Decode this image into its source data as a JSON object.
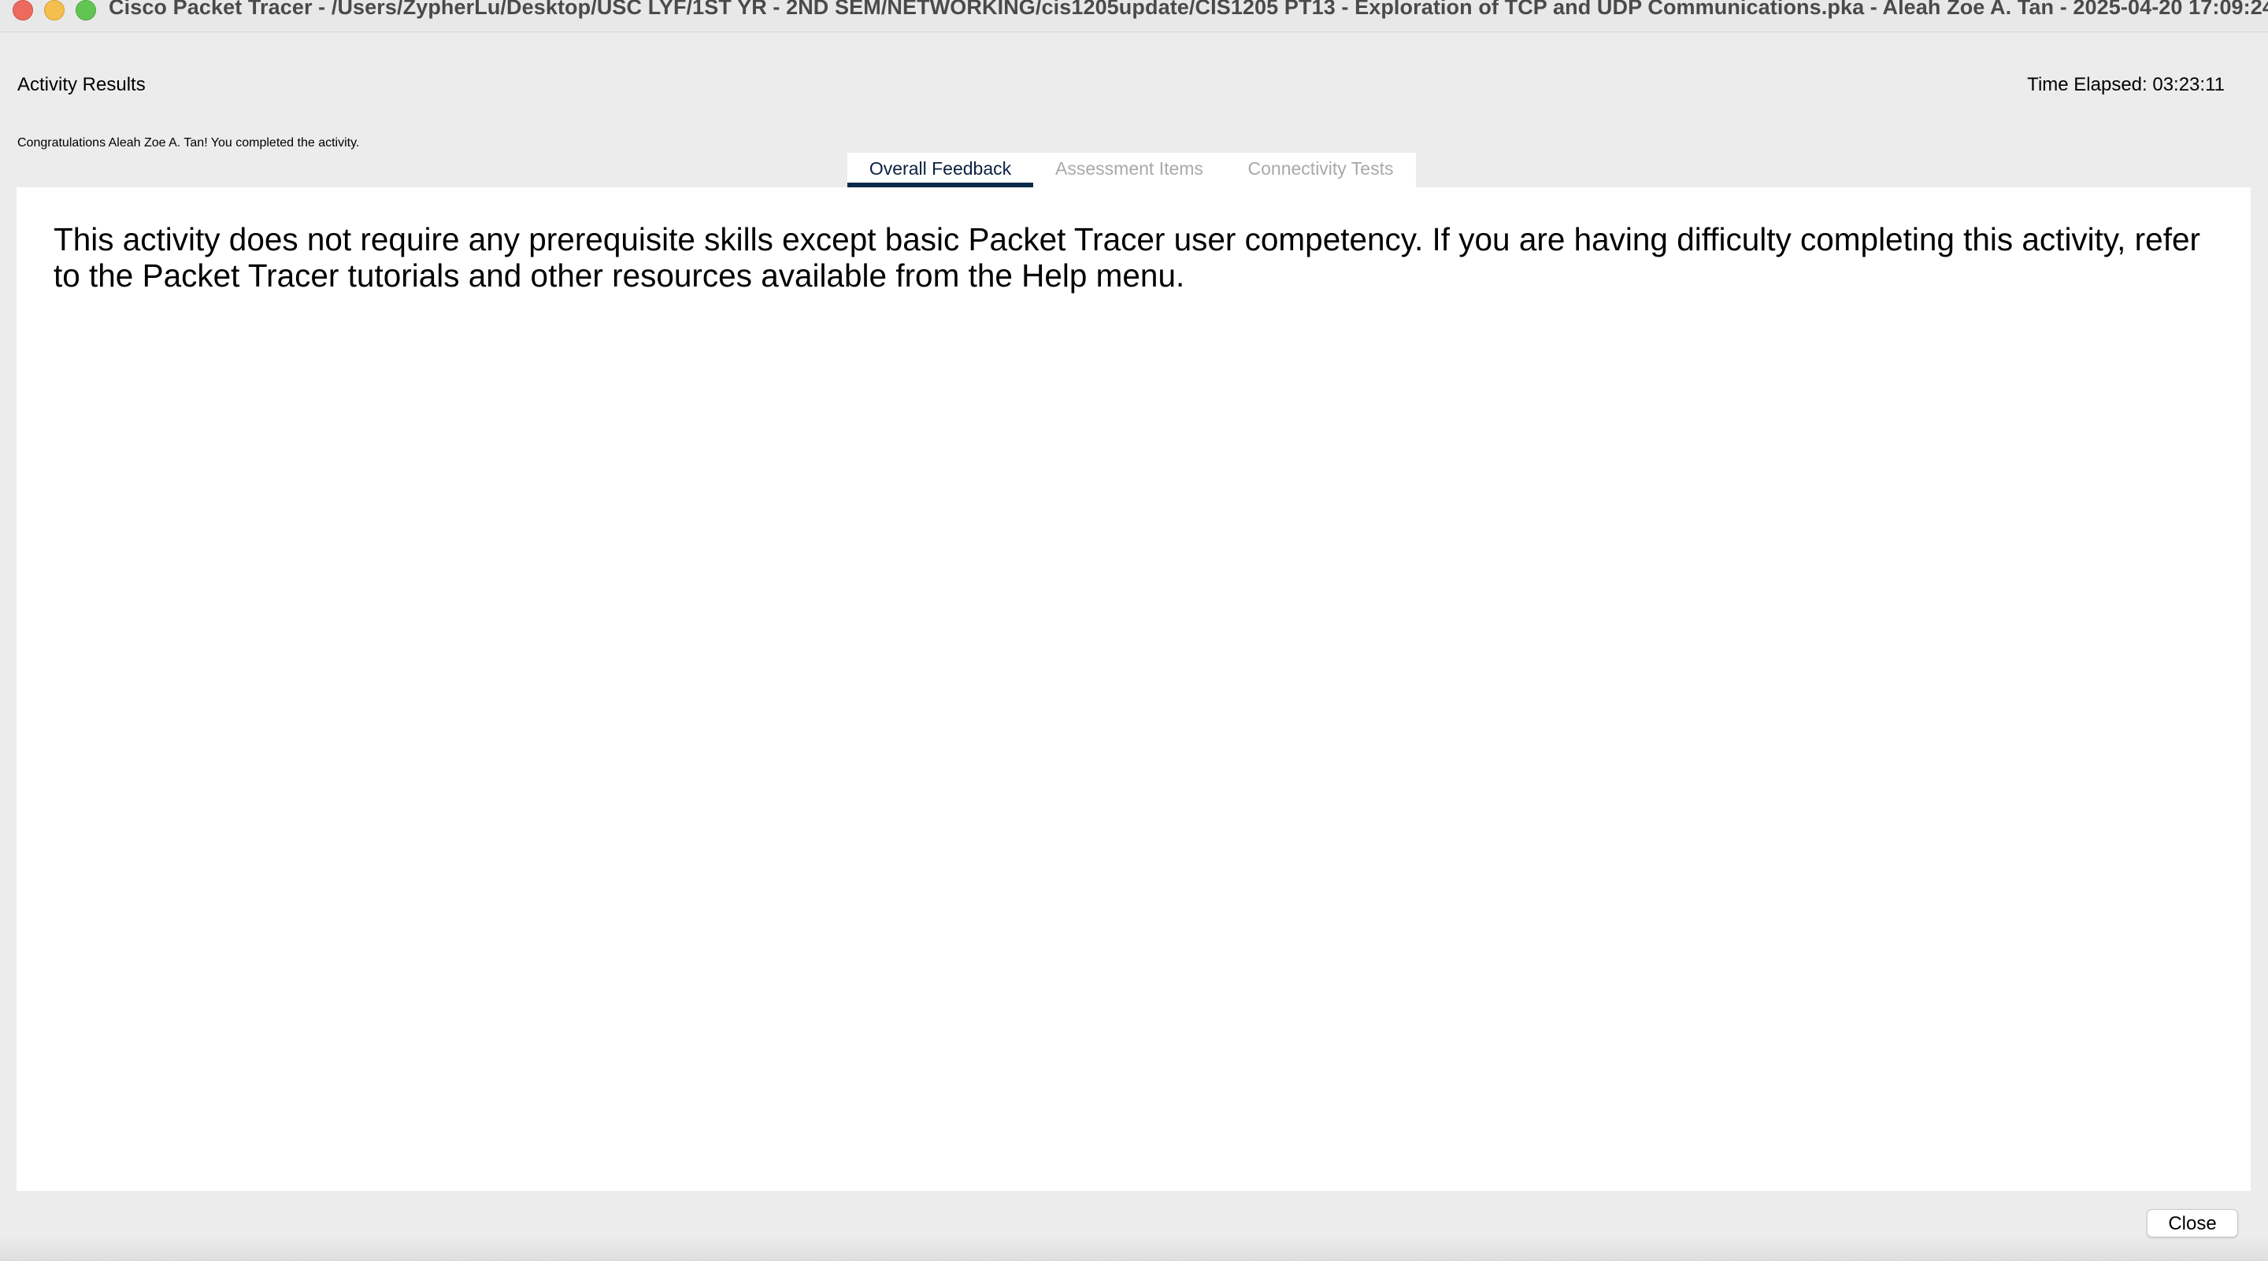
{
  "window": {
    "title": "Cisco Packet Tracer - /Users/ZypherLu/Desktop/USC LYF/1ST YR - 2ND SEM/NETWORKING/cis1205update/CIS1205 PT13 - Exploration of TCP and UDP Communications.pka - Aleah Zoe A. Tan - 2025-04-20 17:09:24",
    "controls": {
      "close_color": "#ed6a5e",
      "minimize_color": "#f5bf4f",
      "maximize_color": "#61c554"
    }
  },
  "dialog": {
    "title": "Activity Results",
    "time_elapsed": "Time Elapsed: 03:23:11",
    "congratulations": "Congratulations Aleah Zoe A. Tan! You completed the activity."
  },
  "tabs": [
    {
      "label": "Overall Feedback",
      "active": true
    },
    {
      "label": "Assessment Items",
      "active": false
    },
    {
      "label": "Connectivity Tests",
      "active": false
    }
  ],
  "feedback": {
    "text": "This activity does not require any prerequisite skills except basic Packet Tracer user competency. If you are having difficulty completing this activity, refer to the Packet Tracer tutorials and other resources available from the Help menu."
  },
  "footer": {
    "close_label": "Close"
  },
  "colors": {
    "active_tab_underline": "#0d2a4b",
    "inactive_tab_text": "#a9a9a9",
    "background": "#ececec"
  }
}
